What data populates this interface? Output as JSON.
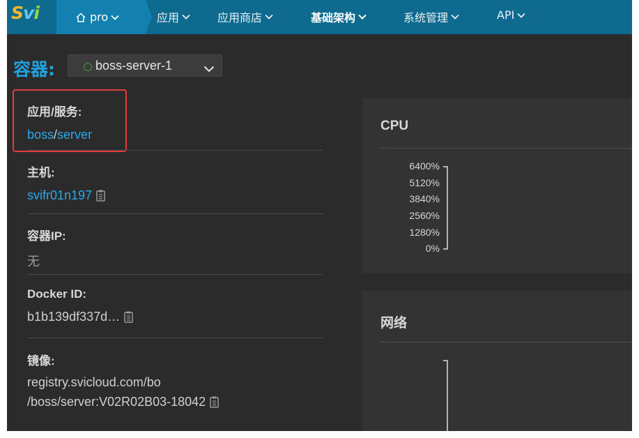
{
  "brand": {
    "logo_s": "S",
    "logo_v": "v",
    "logo_i": "i"
  },
  "nav": {
    "project": "pro",
    "items": [
      {
        "label": "应用"
      },
      {
        "label": "应用商店"
      },
      {
        "label": "基础架构",
        "active": true
      },
      {
        "label": "系统管理"
      },
      {
        "label": "API"
      }
    ]
  },
  "container": {
    "title": "容器:",
    "selected": "boss-server-1",
    "status_color": "#3e9a3a"
  },
  "info": {
    "app_service": {
      "label": "应用/服务:",
      "app": "boss",
      "sep": "/",
      "service": "server"
    },
    "host": {
      "label": "主机:",
      "value": "svifr01n197"
    },
    "ip": {
      "label": "容器IP:",
      "value": "无"
    },
    "docker_id": {
      "label": "Docker ID:",
      "value": "b1b139df337d…"
    },
    "image": {
      "label": "镜像:",
      "line1": "registry.svicloud.com/bo",
      "line2": "/boss/server:V02R02B03-18042"
    }
  },
  "cpu": {
    "title": "CPU",
    "ticks": [
      "6400%",
      "5120%",
      "3840%",
      "2560%",
      "1280%",
      "0%"
    ]
  },
  "network": {
    "title": "网络"
  },
  "colors": {
    "accent": "#1fa2e0",
    "nav": "#0f6a8f",
    "highlight": "#e23c3c"
  }
}
